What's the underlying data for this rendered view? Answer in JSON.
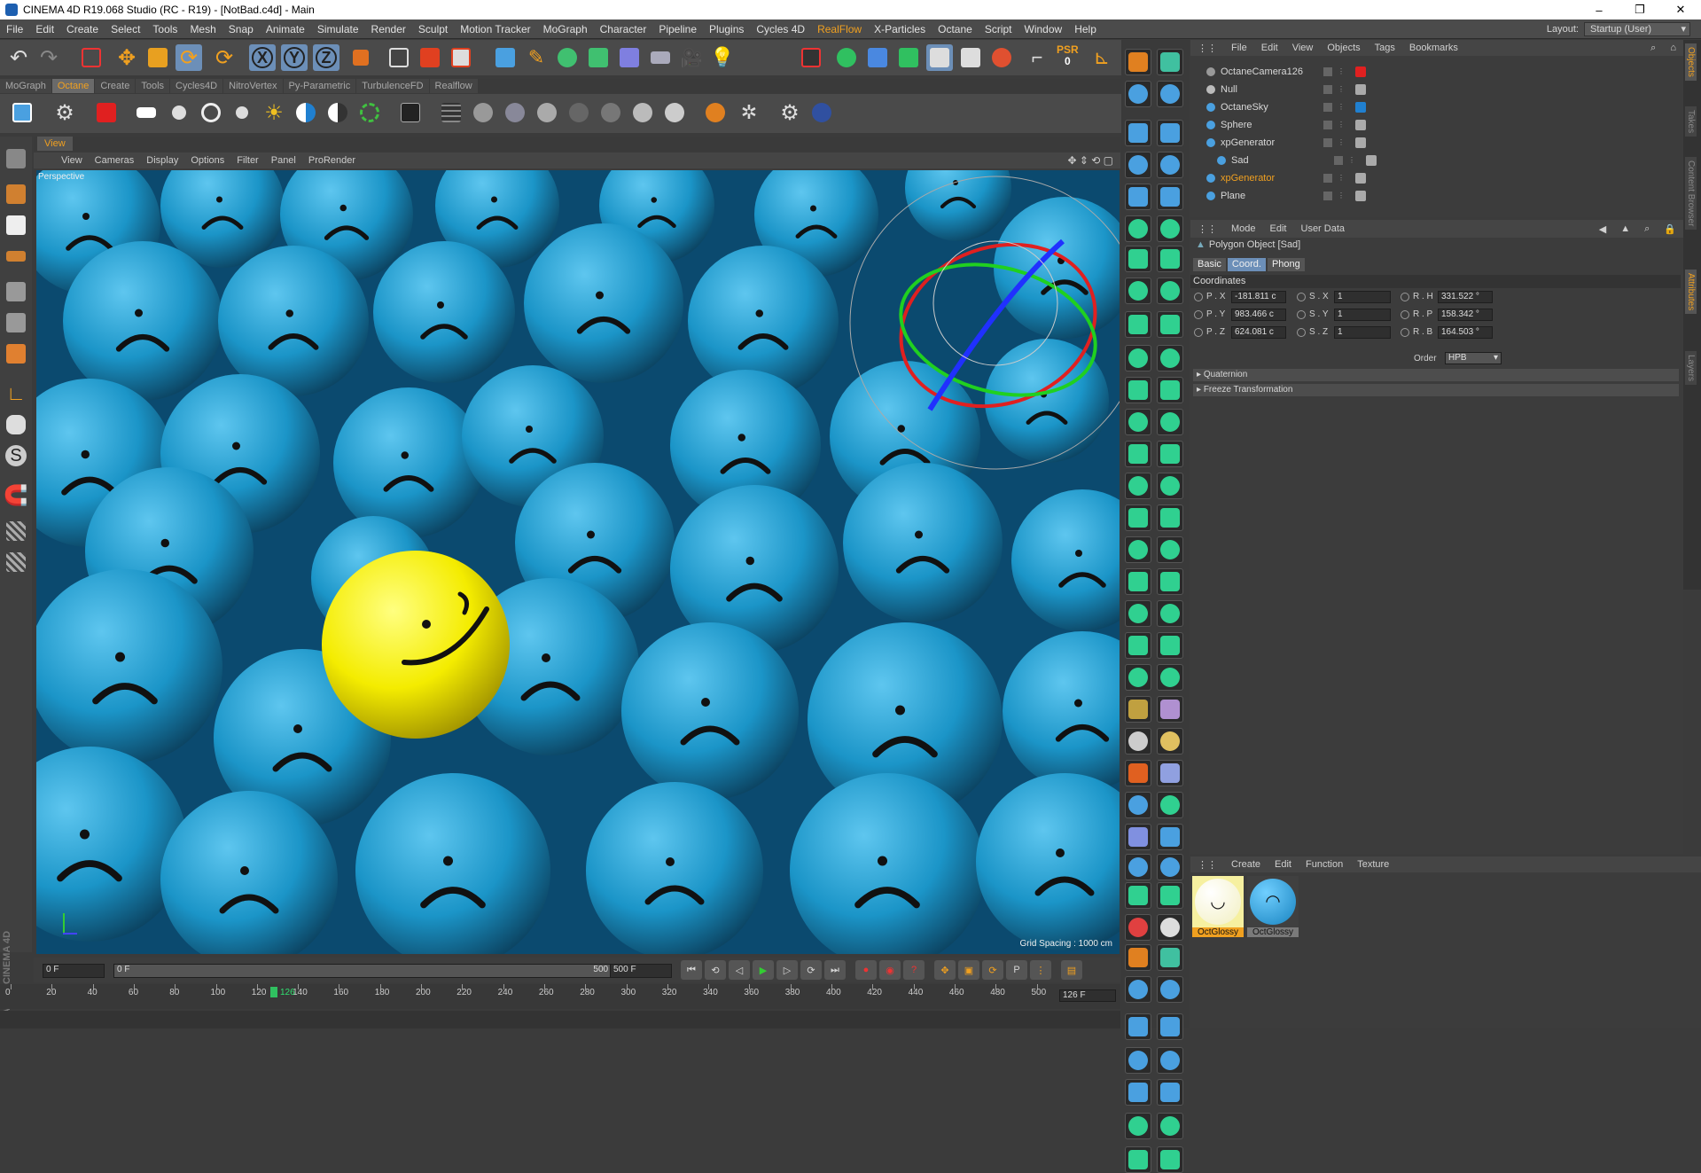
{
  "window": {
    "title": "CINEMA 4D R19.068 Studio (RC - R19) - [NotBad.c4d] - Main",
    "minimize": "–",
    "maximize": "❐",
    "close": "✕"
  },
  "menu": [
    "File",
    "Edit",
    "Create",
    "Select",
    "Tools",
    "Mesh",
    "Snap",
    "Animate",
    "Simulate",
    "Render",
    "Sculpt",
    "Motion Tracker",
    "MoGraph",
    "Character",
    "Pipeline",
    "Plugins",
    "Cycles 4D",
    "RealFlow",
    "X-Particles",
    "Octane",
    "Script",
    "Window",
    "Help"
  ],
  "layout": {
    "label": "Layout:",
    "value": "Startup (User)"
  },
  "toolbar": {
    "psr_label": "PSR",
    "psr_value": "0",
    "undo": "↶",
    "redo": "↷"
  },
  "palette_tabs": [
    "MoGraph",
    "Octane",
    "Create",
    "Tools",
    "Cycles4D",
    "NitroVertex",
    "Py-Parametric",
    "TurbulenceFD",
    "Realflow"
  ],
  "palette_active": "Octane",
  "viewport": {
    "tab": "View",
    "menu": [
      "View",
      "Cameras",
      "Display",
      "Options",
      "Filter",
      "Panel",
      "ProRender"
    ],
    "label": "Perspective",
    "grid": "Grid Spacing : 1000 cm"
  },
  "objects": {
    "menu": [
      "File",
      "Edit",
      "View",
      "Objects",
      "Tags",
      "Bookmarks"
    ],
    "items": [
      {
        "name": "OctaneCamera126",
        "indent": 0
      },
      {
        "name": "Null",
        "indent": 0
      },
      {
        "name": "OctaneSky",
        "indent": 0
      },
      {
        "name": "Sphere",
        "indent": 0
      },
      {
        "name": "xpGenerator",
        "indent": 0
      },
      {
        "name": "Sad",
        "indent": 1
      },
      {
        "name": "xpGenerator",
        "indent": 0,
        "highlight": true
      },
      {
        "name": "Plane",
        "indent": 0
      }
    ]
  },
  "attributes": {
    "menu": [
      "Mode",
      "Edit",
      "User Data"
    ],
    "object": "Polygon Object [Sad]",
    "tabs": [
      "Basic",
      "Coord.",
      "Phong"
    ],
    "active_tab": "Coord.",
    "section": "Coordinates",
    "rows": [
      {
        "p_label": "P . X",
        "p_value": "-181.811 c",
        "s_label": "S . X",
        "s_value": "1",
        "r_label": "R . H",
        "r_value": "331.522 °"
      },
      {
        "p_label": "P . Y",
        "p_value": "983.466 c",
        "s_label": "S . Y",
        "s_value": "1",
        "r_label": "R . P",
        "r_value": "158.342 °"
      },
      {
        "p_label": "P . Z",
        "p_value": "624.081 c",
        "s_label": "S . Z",
        "s_value": "1",
        "r_label": "R . B",
        "r_value": "164.503 °"
      }
    ],
    "order_label": "Order",
    "order_value": "HPB",
    "quaternion": "Quaternion",
    "freeze": "Freeze Transformation"
  },
  "right_tabs": [
    "Objects",
    "Takes",
    "Content Browser",
    "Attributes",
    "Layers"
  ],
  "materials": {
    "menu": [
      "Create",
      "Edit",
      "Function",
      "Texture"
    ],
    "items": [
      {
        "name": "OctGlossy",
        "kind": "happy"
      },
      {
        "name": "OctGlossy",
        "kind": "sad"
      }
    ]
  },
  "timeline": {
    "start": "0 F",
    "current": "0 F",
    "end_slider": "500 F",
    "end": "500 F",
    "frame": "126 F",
    "playhead": "126",
    "ticks": [
      "0",
      "20",
      "40",
      "60",
      "80",
      "100",
      "120",
      "140",
      "160",
      "180",
      "200",
      "220",
      "240",
      "260",
      "280",
      "300",
      "320",
      "340",
      "360",
      "380",
      "400",
      "420",
      "440",
      "460",
      "480",
      "500"
    ]
  },
  "brand": "MAXON CINEMA 4D"
}
